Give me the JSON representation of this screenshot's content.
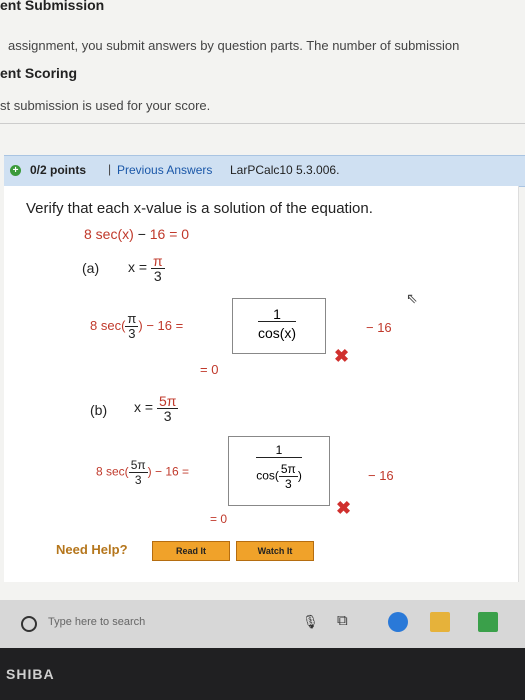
{
  "page": {
    "header_submission": "ent Submission",
    "submission_line": "assignment, you submit answers by question parts. The number of submission",
    "header_scoring": "ent Scoring",
    "scoring_line": "st submission is used for your score."
  },
  "question": {
    "points": "0/2 points",
    "separator": "|",
    "previous_answers": "Previous Answers",
    "code": "LarPCalc10 5.3.006.",
    "prompt": "Verify that each x-value is a solution of the equation.",
    "equation_lhs": "8 sec(x)",
    "equation_minus": "−",
    "equation_rhs": "16 = 0"
  },
  "part_a": {
    "label": "(a)",
    "x_eq": "x =",
    "x_num": "π",
    "x_den": "3",
    "expr_prefix": "8 sec(",
    "expr_num": "π",
    "expr_den": "3",
    "expr_suffix": ") − 16 =",
    "box_num": "1",
    "box_den": "cos(x)",
    "after_box": "− 16",
    "result": "= 0",
    "mark": "✖"
  },
  "part_b": {
    "label": "(b)",
    "x_eq": "x =",
    "x_num": "5π",
    "x_den": "3",
    "expr_prefix": "8 sec(",
    "expr_num": "5π",
    "expr_den": "3",
    "expr_suffix": ") − 16 =",
    "box_num": "1",
    "box_den_pre": "cos(",
    "box_den_num": "5π",
    "box_den_den": "3",
    "box_den_post": ")",
    "after_box": "− 16",
    "result": "= 0",
    "mark": "✖"
  },
  "help": {
    "need_help": "Need Help?",
    "read_it": "Read It",
    "watch_it": "Watch It"
  },
  "taskbar": {
    "search_placeholder": "Type here to search"
  },
  "bezel": {
    "brand": "SHIBA"
  },
  "colors": {
    "accent_red": "#c0392b",
    "question_bar": "#cfe0f2",
    "help_button": "#f0a22a",
    "link_blue": "#1a57a8"
  }
}
